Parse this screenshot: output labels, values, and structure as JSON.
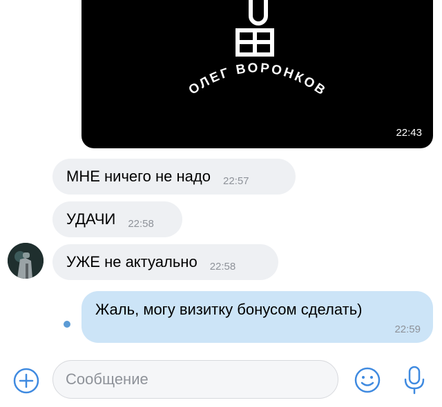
{
  "messages": {
    "image": {
      "brand_name": "ОЛЕГ ВОРОНКОВ",
      "brand_mark": "ВО",
      "time": "22:43"
    },
    "incoming": [
      {
        "text": "МНЕ ничего не надо",
        "time": "22:57"
      },
      {
        "text": "УДАЧИ",
        "time": "22:58"
      },
      {
        "text": "УЖЕ не актуально",
        "time": "22:58"
      }
    ],
    "outgoing": {
      "text": "Жаль, могу визитку бонусом сделать)",
      "time": "22:59"
    }
  },
  "composer": {
    "placeholder": "Сообщение"
  },
  "icons": {
    "attach": "plus-circle-icon",
    "emoji": "smiley-icon",
    "mic": "microphone-icon"
  },
  "colors": {
    "accent": "#3f8ae0",
    "incoming_bubble": "#eef0f3",
    "outgoing_bubble": "#cce4f7",
    "time_text": "#8e9299"
  }
}
